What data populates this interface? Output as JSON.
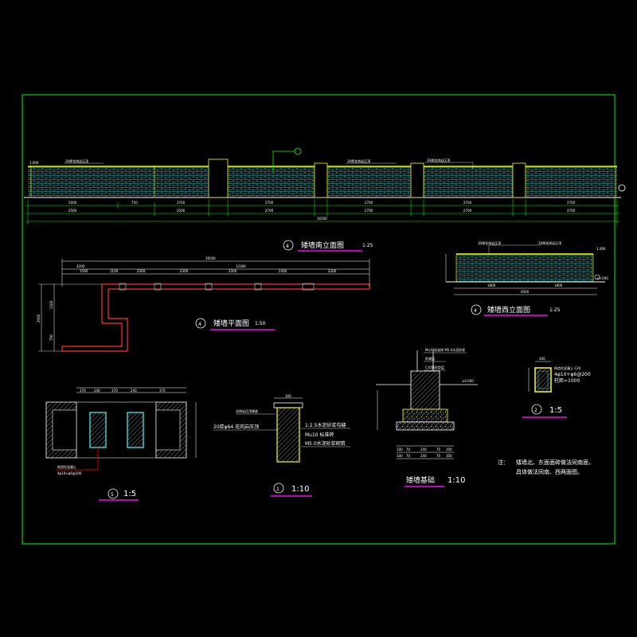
{
  "drawing": {
    "colors": {
      "background": "#000000",
      "frame": "#00ff00",
      "dim": "#00ff00",
      "brick": "#3cc8c8",
      "cap": "#ffff00",
      "leader": "#00ff00",
      "plan_wall": "#ff3030",
      "title_underline": "#ff00ff",
      "text": "#ffffff",
      "hatch": "#a0a0a0",
      "red_leader": "#ff0000"
    }
  },
  "views": {
    "south_elevation": {
      "number": "4",
      "title": "矮墙南立面图",
      "scale": "1:25",
      "level": "1.000",
      "dims_row1": [
        "2000",
        "750",
        "2700",
        "2700",
        "2700",
        "2700",
        "2700"
      ],
      "dims_row2": [
        "2500",
        "2500",
        "2700",
        "2700",
        "2700",
        "2700"
      ],
      "dim_total": "16500",
      "callout": "①",
      "note_a": "30厚花岗岩压顶",
      "note_b": "30厚花岗岩压顶",
      "note_c": "30厚花岗岩压顶"
    },
    "plan": {
      "number": "4",
      "title": "矮墙平面图",
      "scale": "1:50",
      "dim_total": "16500",
      "dims_top": [
        "4200",
        "12300"
      ],
      "dims_row2": [
        "1500",
        "1100",
        "2300",
        "2300",
        "2300",
        "2300",
        "2300"
      ],
      "dims_left": [
        "2000",
        "1200",
        "750"
      ]
    },
    "west_elevation": {
      "number": "4",
      "title": "矮墙西立面图",
      "scale": "1:25",
      "level_top": "1.000",
      "level_bottom": "±0.000",
      "dims": [
        "1800",
        "1800"
      ],
      "dim_total": "4000",
      "note_a": "30厚花岗岩压顶",
      "note_b": "30厚花岗岩压顶"
    },
    "detail_5": {
      "number": "5",
      "scale": "1:5",
      "note1": "构造柱混凝土",
      "note2": "4φ10+φ6@200",
      "dims": [
        "370",
        "240",
        "370",
        "240",
        "370"
      ]
    },
    "detail_1": {
      "number": "1",
      "scale": "1:10",
      "note_top": "花岗岩压顶厚度",
      "note_l1": "20厚φ64 花岗岩压顶",
      "note_r1": "1:2.5水泥砂浆勾缝",
      "note_r2": "Mu10 标准砖",
      "note_r3": "M5.0水泥砂浆砌筑"
    },
    "foundation": {
      "title": "矮墙基础",
      "scale": "1:10",
      "level": "±0.000",
      "notes": [
        "Mu10标准砖 M5.0水泥砂浆",
        "防潮层",
        "C10素砼垫层"
      ],
      "dims_row1": [
        "100",
        "70",
        "240",
        "70",
        "100"
      ],
      "dims_row2": [
        "100",
        "70",
        "240",
        "70",
        "100"
      ]
    },
    "detail_2": {
      "number": "2",
      "scale": "1:5",
      "note1": "构造柱混凝土 C20",
      "note2": "4φ10+φ6@200",
      "note3": "柱距=1000",
      "dim": "300"
    },
    "general_note": {
      "label": "注：",
      "line1": "矮墙北、东面面砖做法同南面，",
      "line2": "具体做法同南、西两面图。"
    }
  }
}
